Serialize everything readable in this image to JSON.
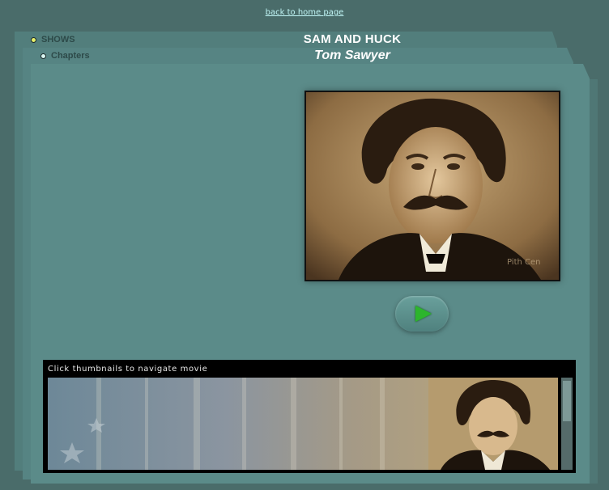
{
  "top_link": {
    "label": "back to home page"
  },
  "nav": {
    "shows": {
      "label": "SHOWS"
    },
    "chapters": {
      "label": "Chapters"
    }
  },
  "header": {
    "title": "SAM AND HUCK",
    "subtitle": "Tom Sawyer"
  },
  "photo": {
    "watermark": "Pith Cen"
  },
  "player": {
    "play_icon": "play-icon"
  },
  "filmstrip": {
    "instruction": "Click thumbnails to navigate movie"
  },
  "colors": {
    "background": "#4a6c6a",
    "panel": "#5b8b89",
    "link": "#bff4f4",
    "play": "#2cb52c"
  }
}
